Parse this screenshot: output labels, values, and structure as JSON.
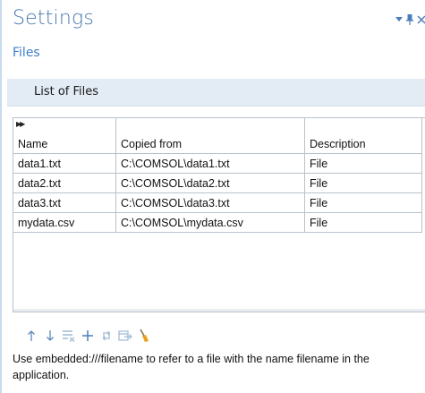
{
  "header": {
    "title": "Settings",
    "subtitle": "Files"
  },
  "window_controls": {
    "menu_icon": "dropdown-arrow",
    "pin_icon": "pin",
    "close_icon": "close-x"
  },
  "section": {
    "label": "List of Files"
  },
  "table": {
    "columns": [
      "Name",
      "Copied from",
      "Description"
    ],
    "rows": [
      {
        "name": "data1.txt",
        "copied_from": "C:\\COMSOL\\data1.txt",
        "description": "File"
      },
      {
        "name": "data2.txt",
        "copied_from": "C:\\COMSOL\\data2.txt",
        "description": "File"
      },
      {
        "name": "data3.txt",
        "copied_from": "C:\\COMSOL\\data3.txt",
        "description": "File"
      },
      {
        "name": "mydata.csv",
        "copied_from": "C:\\COMSOL\\mydata.csv",
        "description": "File"
      }
    ]
  },
  "toolbar": {
    "buttons": [
      "move-up",
      "move-down",
      "delete",
      "add",
      "refresh",
      "export",
      "clear"
    ]
  },
  "info_text": "Use embedded:///filename to refer to a file with the name filename in the application.",
  "colors": {
    "title": "#4a7ab0",
    "subtitle": "#3f7fc6",
    "section_bg": "#e3ebf4",
    "icon_blue": "#4a7fba"
  }
}
